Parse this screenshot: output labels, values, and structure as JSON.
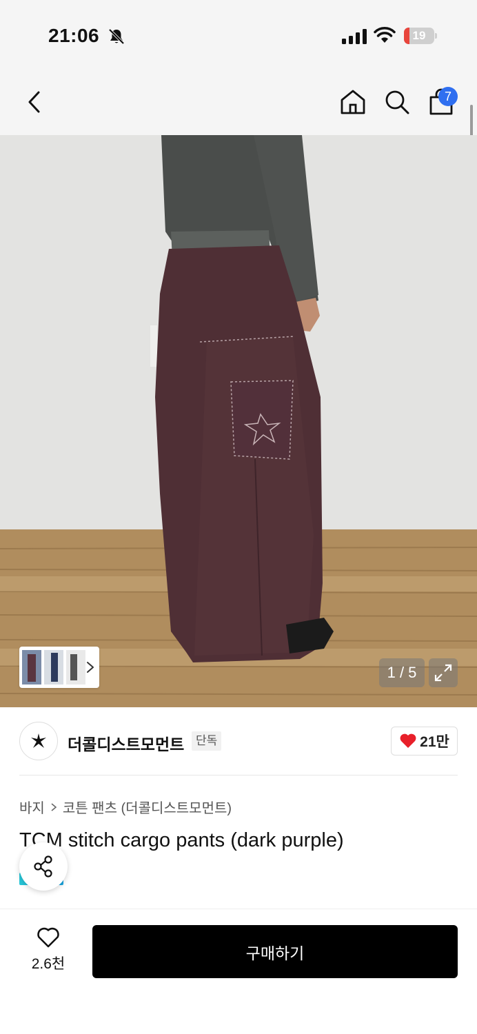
{
  "status_bar": {
    "time": "21:06",
    "battery_level": "19",
    "battery_fraction": 0.19,
    "icons": [
      "bell-slash-icon",
      "cellular-signal-icon",
      "wifi-icon",
      "battery-icon"
    ]
  },
  "top_nav": {
    "icons": [
      "chevron-left-icon",
      "home-icon",
      "search-icon",
      "shopping-bag-icon"
    ],
    "cart_count": "7"
  },
  "product_image": {
    "counter": "1 / 5",
    "icons": [
      "chevron-right-icon",
      "expand-icon"
    ]
  },
  "brand": {
    "name": "더콜디스트모먼트",
    "badge": "단독",
    "likes": "21만",
    "icons": [
      "brand-logo-icon",
      "heart-filled-icon"
    ]
  },
  "breadcrumb": {
    "items": [
      "바지",
      "코튼 팬츠 (더콜디스트모먼트)"
    ]
  },
  "product": {
    "title": "TCM stitch cargo pants (dark purple)"
  },
  "bottom_bar": {
    "wish_count": "2.6천",
    "buy_label": "구매하기",
    "icons": [
      "heart-outline-icon",
      "share-icon"
    ]
  },
  "colors": {
    "accent_blue": "#2f6ff0",
    "like_red": "#e8202a",
    "buy_button": "#000000",
    "battery_red": "#e8453c"
  }
}
